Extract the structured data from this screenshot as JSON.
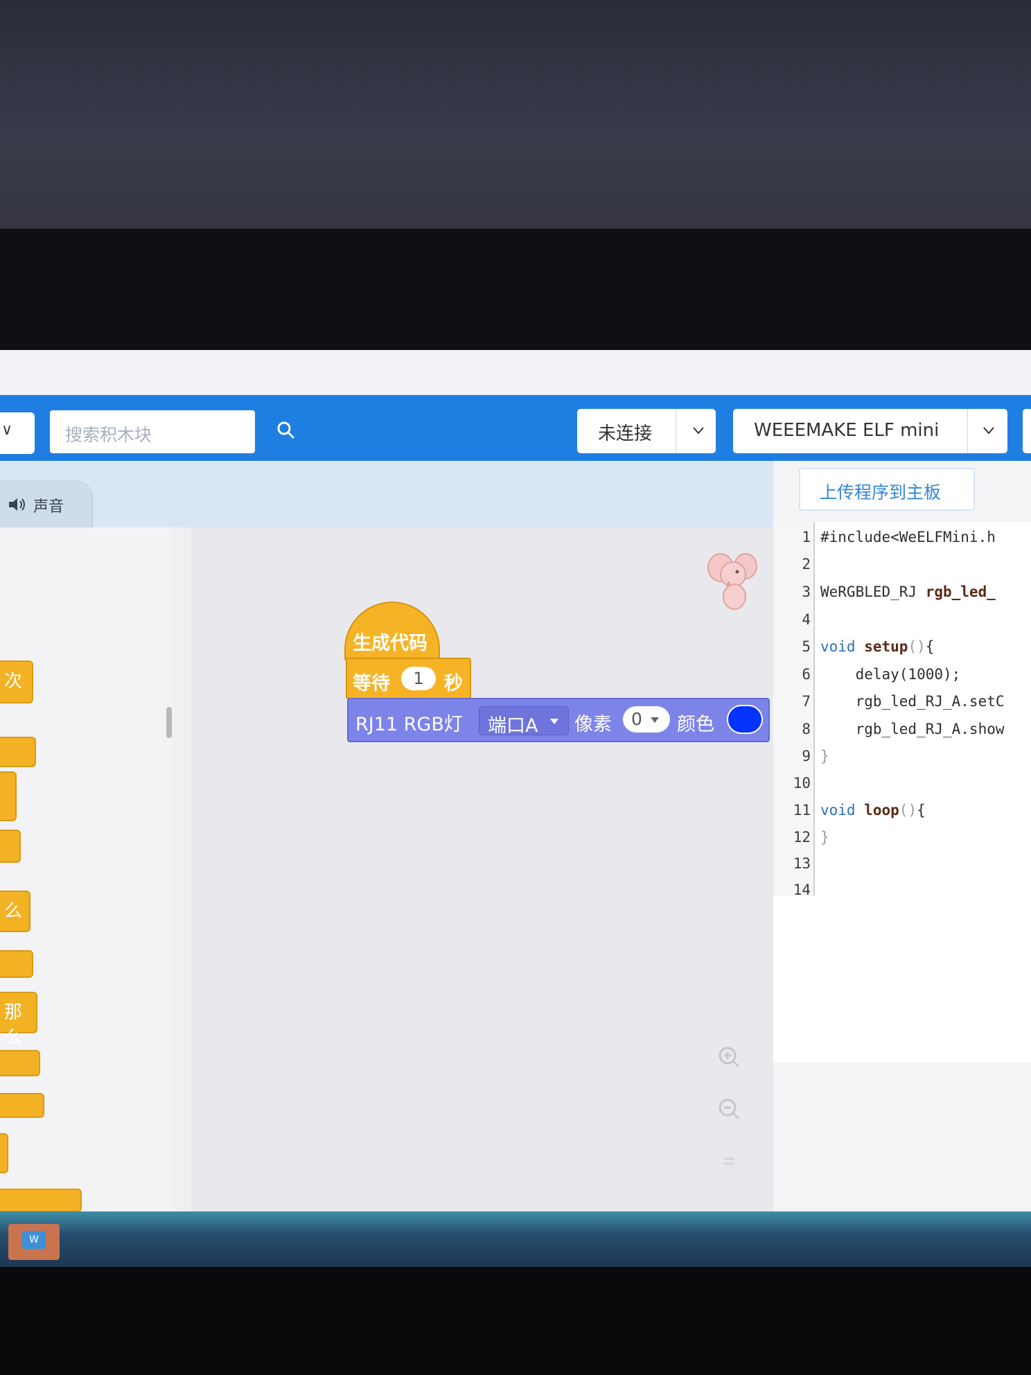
{
  "toolbar": {
    "search_placeholder": "搜索积木块",
    "connection_label": "未连接",
    "board_label": "WEEEMAKE ELF mini",
    "accent_color": "#1e7ee2"
  },
  "category_tab": {
    "label": "声音",
    "icon": "speaker-icon"
  },
  "palette_fragments": [
    "次",
    "么",
    "那么"
  ],
  "blocks": {
    "hat_label": "生成代码",
    "wait_prefix": "等待",
    "wait_value": "1",
    "wait_suffix": "秒",
    "rgb_label": "RJ11 RGB灯",
    "port_value": "端口A",
    "pixel_label": "像素",
    "pixel_value": "0",
    "color_label": "颜色",
    "color_value": "#0433ff"
  },
  "upload_button": "上传程序到主板",
  "code": {
    "line_numbers": [
      "1",
      "2",
      "3",
      "4",
      "5",
      "6",
      "7",
      "8",
      "9",
      "10",
      "11",
      "12",
      "13",
      "14"
    ],
    "l1": "#include<WeELFMini.h",
    "l3a": "WeRGBLED_RJ ",
    "l3b": "rgb_led_",
    "l5kw": "void ",
    "l5fn": "setup",
    "l5p": "()",
    "l5b": "{",
    "l6": "    delay(1000);",
    "l7": "    rgb_led_RJ_A.setC",
    "l8": "    rgb_led_RJ_A.show",
    "l9": "}",
    "l11kw": "void ",
    "l11fn": "loop",
    "l11p": "()",
    "l11b": "{",
    "l12": "}"
  },
  "taskbar": {
    "app_icon": "word-icon",
    "app_icon_text": "W"
  }
}
